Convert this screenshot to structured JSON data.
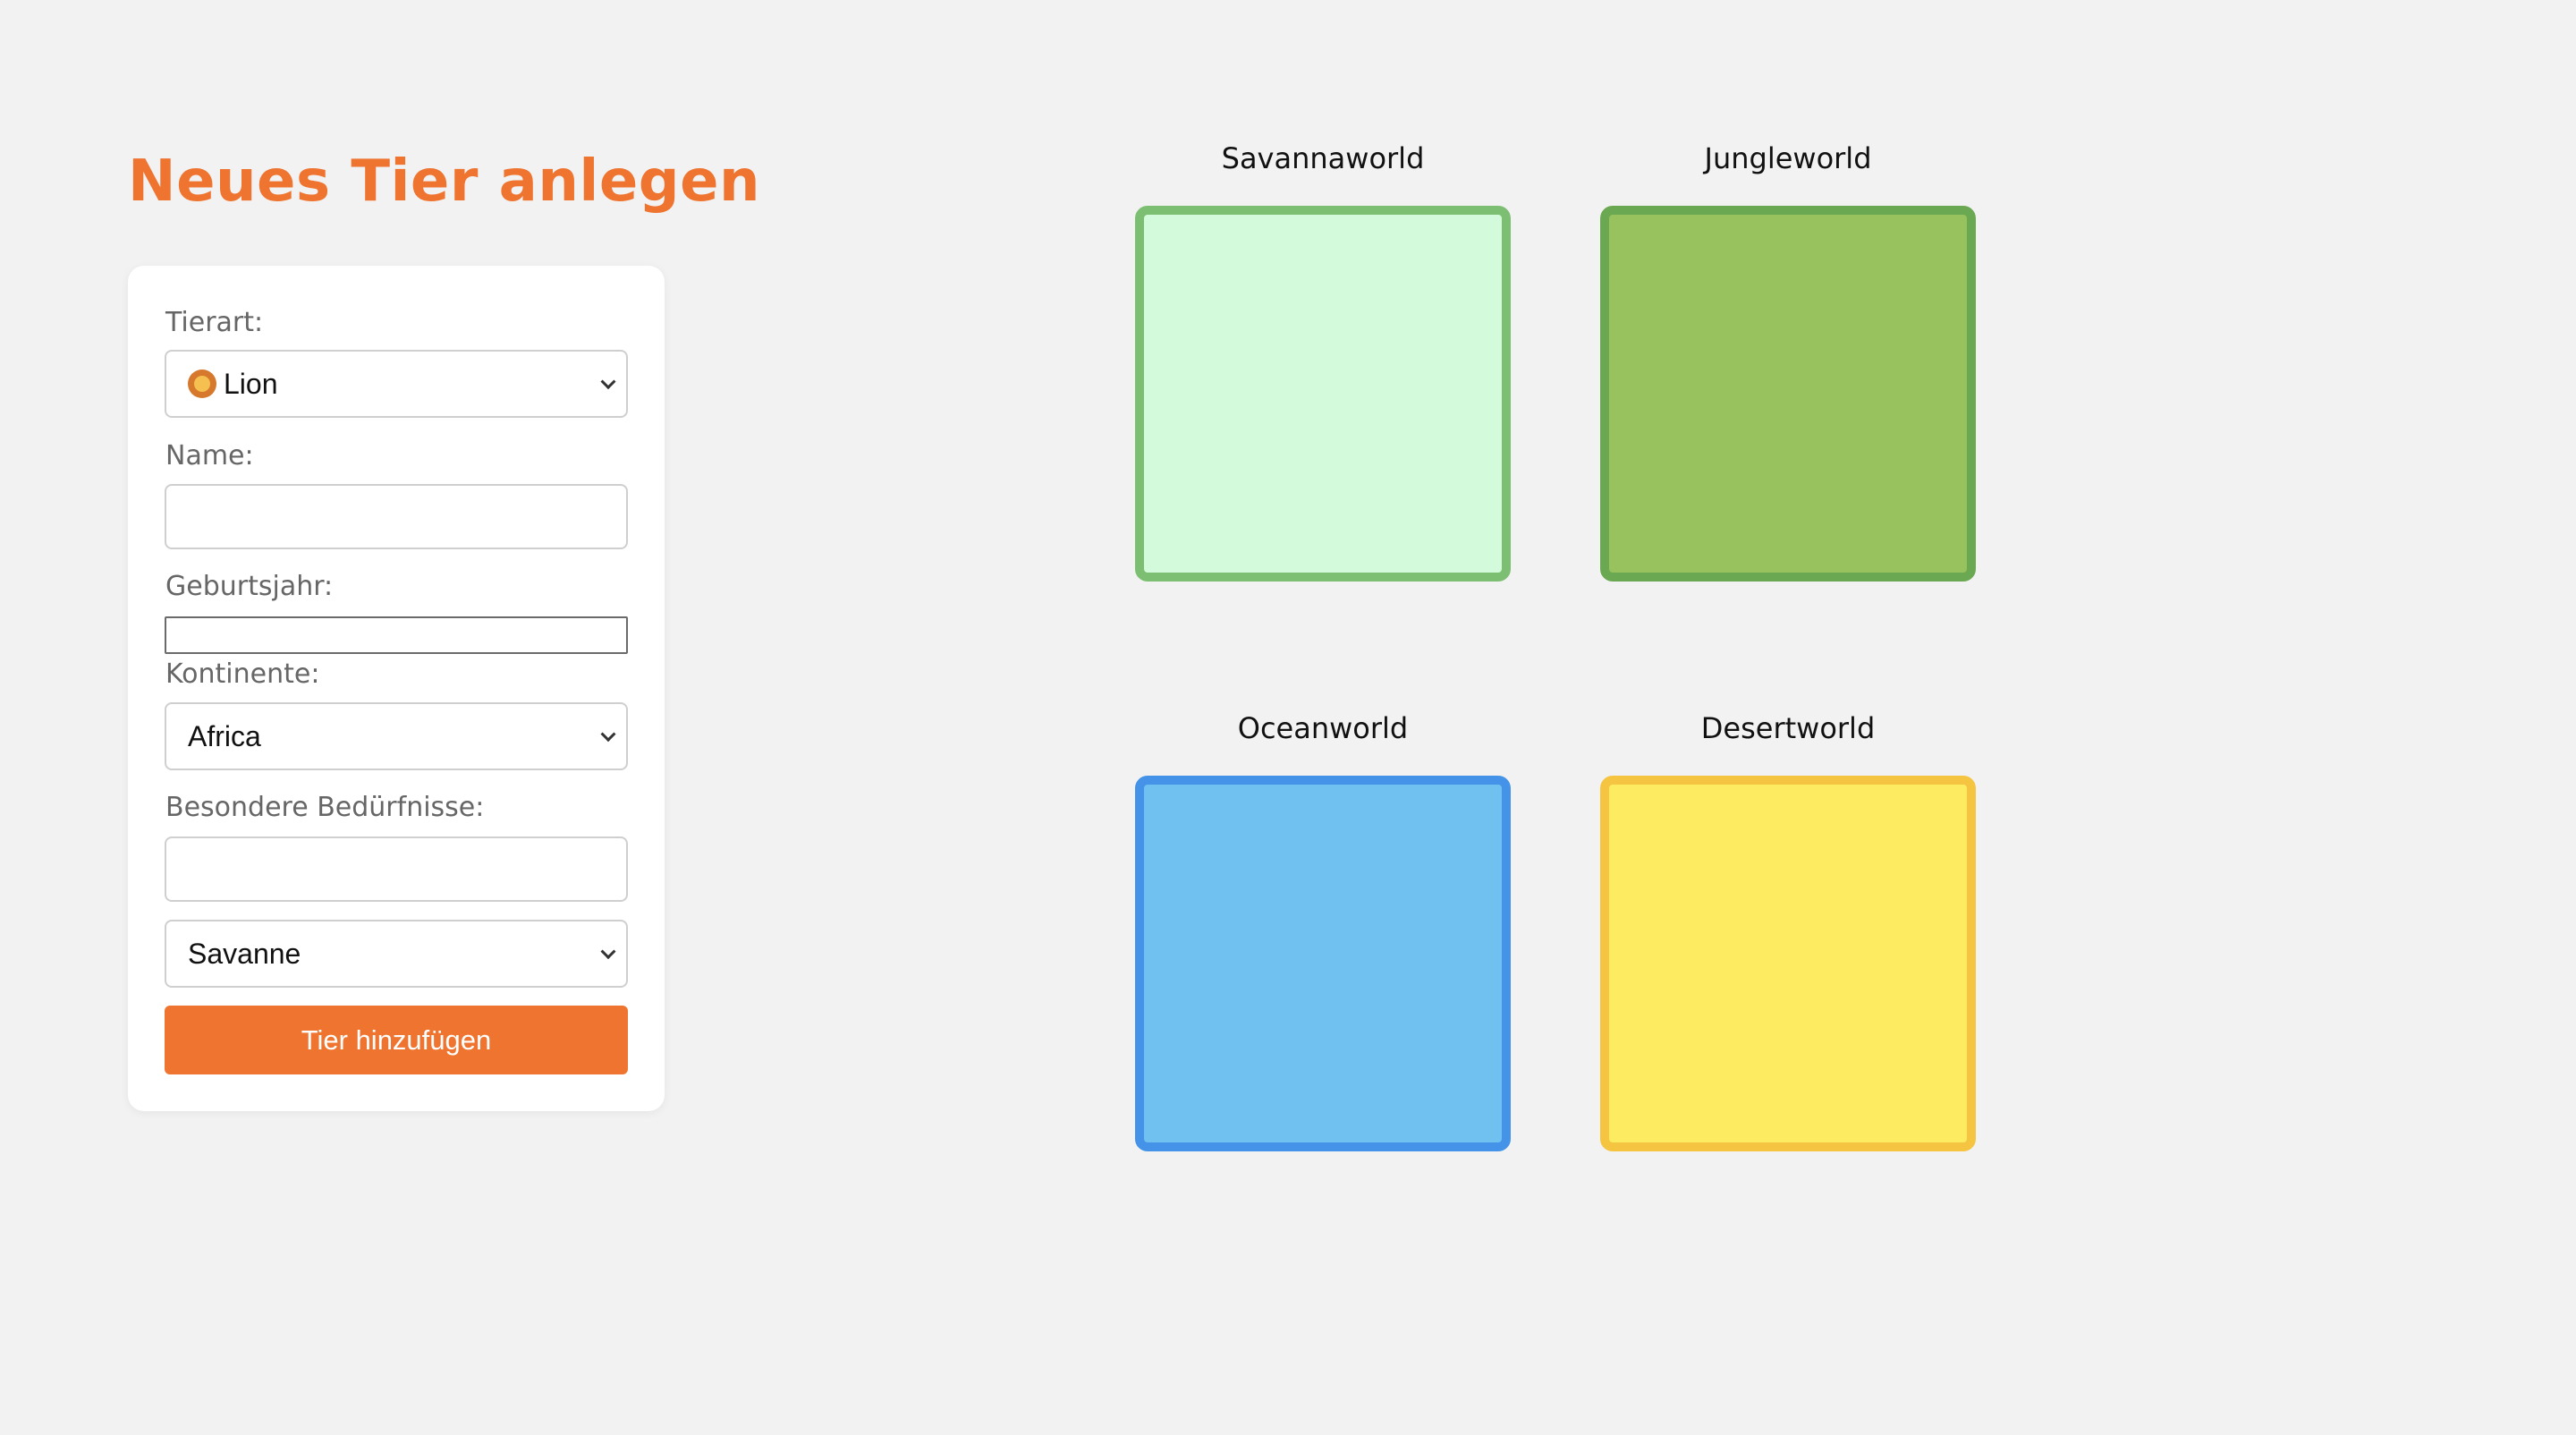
{
  "form": {
    "title": "Neues Tier anlegen",
    "species_label": "Tierart:",
    "species_value": "Lion",
    "species_icon": "lion-face-icon",
    "name_label": "Name:",
    "name_value": "",
    "birthyear_label": "Geburtsjahr:",
    "birthyear_value": "",
    "continent_label": "Kontinente:",
    "continent_value": "Africa",
    "needs_label": "Besondere Bedürfnisse:",
    "needs_value": "",
    "habitat_value": "Savanne",
    "submit_label": "Tier hinzufügen",
    "accent_color": "#ee7430"
  },
  "worlds": [
    {
      "name": "Savannaworld",
      "fill": "#d3fadb",
      "border": "#7dbf72"
    },
    {
      "name": "Jungleworld",
      "fill": "#97c25d",
      "border": "#6aa952"
    },
    {
      "name": "Oceanworld",
      "fill": "#70c0f0",
      "border": "#4493e8"
    },
    {
      "name": "Desertworld",
      "fill": "#fdec62",
      "border": "#f5c541"
    }
  ]
}
